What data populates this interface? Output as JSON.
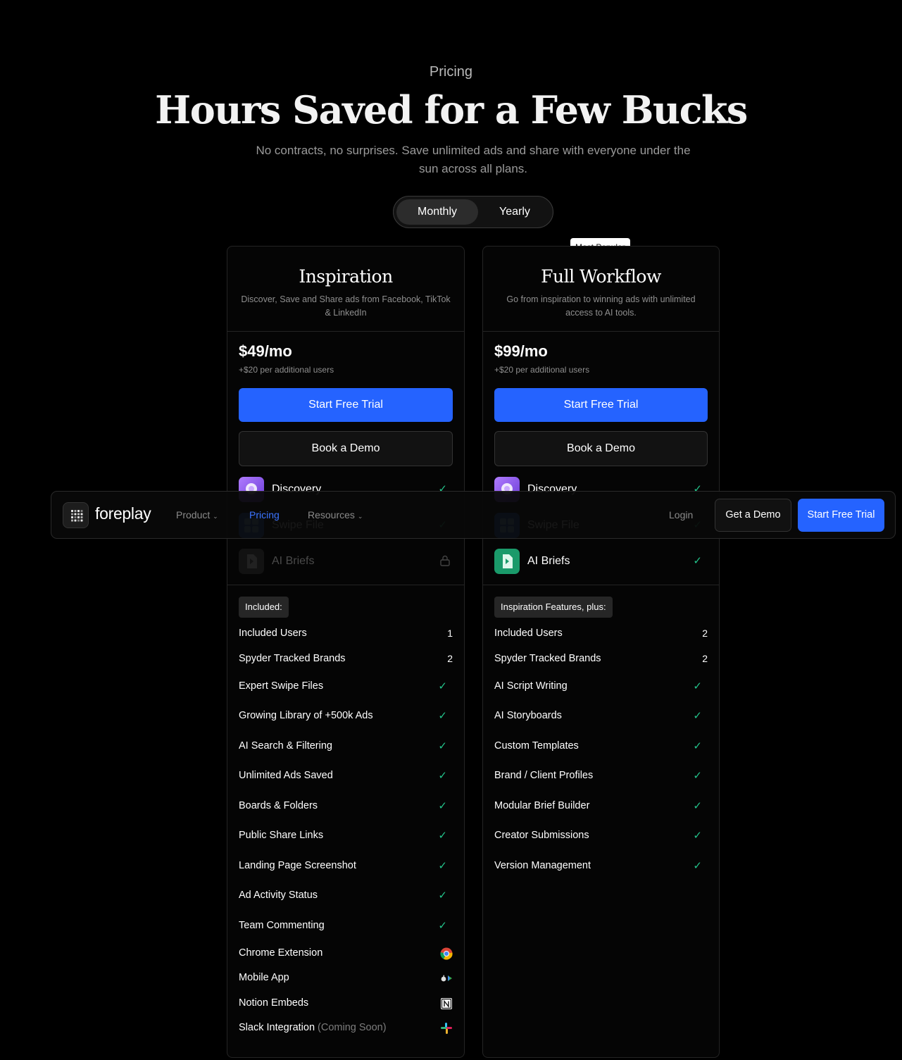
{
  "hero": {
    "eyebrow": "Pricing",
    "title": "Hours Saved for a Few Bucks",
    "subtitle": "No contracts, no surprises. Save unlimited ads and share with everyone under the sun across all plans."
  },
  "billing_toggle": {
    "monthly": "Monthly",
    "yearly": "Yearly",
    "selected": "Monthly"
  },
  "colors": {
    "accent": "#2563ff",
    "check": "#23c28a",
    "background": "#000000"
  },
  "plans": [
    {
      "name": "Inspiration",
      "description": "Discover, Save and Share ads from Facebook, TikTok & LinkedIn",
      "price": "$49/mo",
      "price_note": "+$20 per additional users",
      "primary_cta": "Start Free Trial",
      "secondary_cta": "Book a Demo",
      "tools": [
        {
          "label": "Discovery",
          "icon": "discovery-icon",
          "status": "check"
        },
        {
          "label": "Swipe File",
          "icon": "swipe-file-icon",
          "status": "check"
        },
        {
          "label": "AI Briefs",
          "icon": "ai-briefs-icon",
          "status": "locked"
        }
      ],
      "features_heading": "Included:",
      "features": [
        {
          "label": "Included Users",
          "value": "1"
        },
        {
          "label": "Spyder Tracked Brands",
          "value": "2"
        },
        {
          "label": "Expert Swipe Files",
          "value": "check"
        },
        {
          "label": "Growing Library of +500k Ads",
          "value": "check"
        },
        {
          "label": "AI Search & Filtering",
          "value": "check"
        },
        {
          "label": "Unlimited Ads Saved",
          "value": "check"
        },
        {
          "label": "Boards & Folders",
          "value": "check"
        },
        {
          "label": "Public Share Links",
          "value": "check"
        },
        {
          "label": "Landing Page Screenshot",
          "value": "check"
        },
        {
          "label": "Ad Activity Status",
          "value": "check"
        },
        {
          "label": "Team Commenting",
          "value": "check"
        },
        {
          "label": "Chrome Extension",
          "value": "chrome-icon"
        },
        {
          "label": "Mobile App",
          "value": "app-stores-icon"
        },
        {
          "label": "Notion Embeds",
          "value": "notion-icon"
        },
        {
          "label": "Slack Integration",
          "suffix": "(Coming Soon)",
          "value": "slack-icon"
        }
      ]
    },
    {
      "name": "Full Workflow",
      "badge": "Most Popular",
      "description": "Go from inspiration to winning ads with unlimited access to AI tools.",
      "price": "$99/mo",
      "price_note": "+$20 per additional users",
      "primary_cta": "Start Free Trial",
      "secondary_cta": "Book a Demo",
      "tools": [
        {
          "label": "Discovery",
          "icon": "discovery-icon",
          "status": "check"
        },
        {
          "label": "Swipe File",
          "icon": "swipe-file-icon",
          "status": "check"
        },
        {
          "label": "AI Briefs",
          "icon": "ai-briefs-icon",
          "status": "check"
        }
      ],
      "features_heading": "Inspiration Features, plus:",
      "features": [
        {
          "label": "Included Users",
          "value": "2"
        },
        {
          "label": "Spyder Tracked Brands",
          "value": "2"
        },
        {
          "label": "AI Script Writing",
          "value": "check"
        },
        {
          "label": "AI Storyboards",
          "value": "check"
        },
        {
          "label": "Custom Templates",
          "value": "check"
        },
        {
          "label": "Brand / Client Profiles",
          "value": "check"
        },
        {
          "label": "Modular Brief Builder",
          "value": "check"
        },
        {
          "label": "Creator Submissions",
          "value": "check"
        },
        {
          "label": "Version Management",
          "value": "check"
        }
      ]
    }
  ],
  "navbar": {
    "brand": "foreplay",
    "links": [
      {
        "label": "Product",
        "dropdown": true
      },
      {
        "label": "Pricing",
        "active": true
      },
      {
        "label": "Resources",
        "dropdown": true
      }
    ],
    "login": "Login",
    "demo": "Get a Demo",
    "trial": "Start Free Trial"
  }
}
